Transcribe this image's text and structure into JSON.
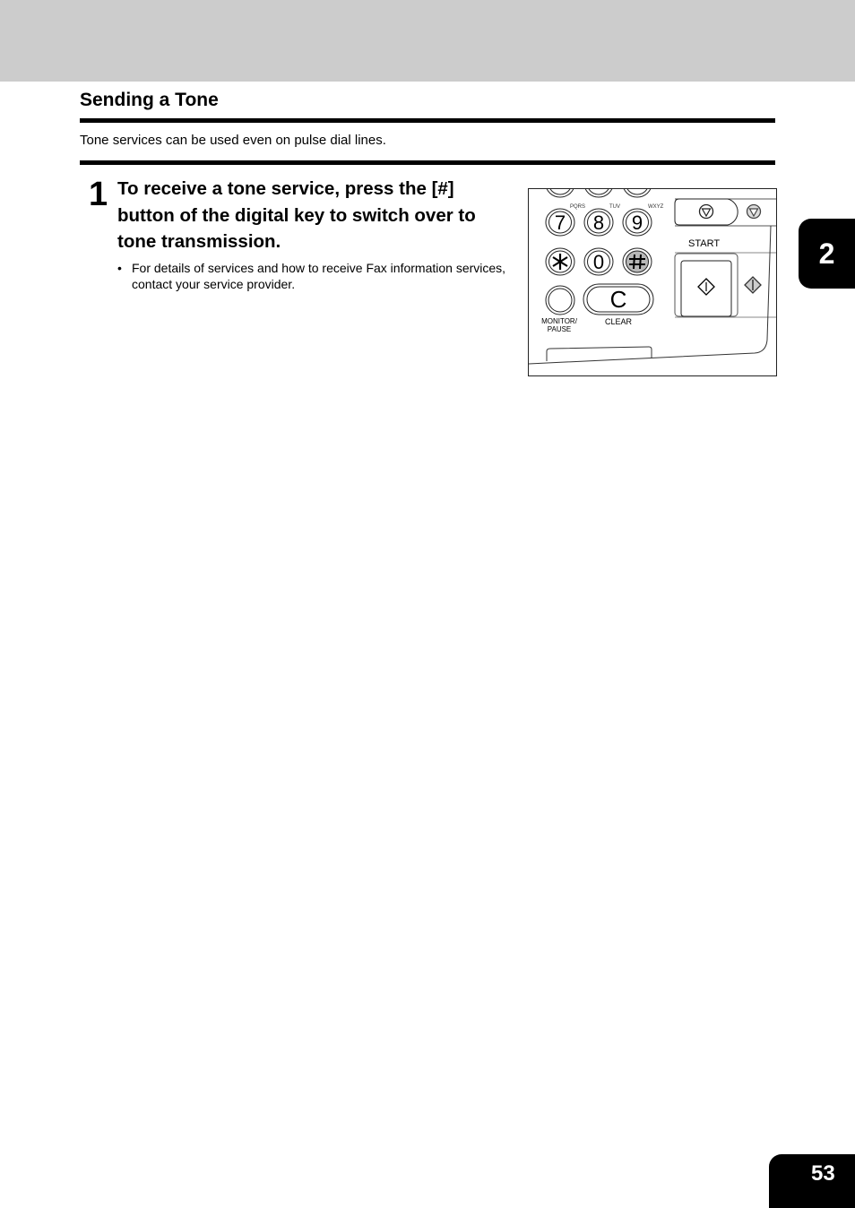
{
  "section": {
    "title": "Sending a Tone",
    "intro": "Tone services can be used even on pulse dial lines."
  },
  "step": {
    "number": "1",
    "instruction": "To receive a tone service, press the [#] button of the digital key to switch over to tone transmission.",
    "bullets": [
      "For details of services and how to receive Fax information services, contact your service provider."
    ],
    "bullet_symbol": "•"
  },
  "figure": {
    "keypad": {
      "letters": [
        "PQRS",
        "TUV",
        "WXYZ"
      ],
      "keys": [
        "7",
        "8",
        "9",
        "*",
        "0",
        "#"
      ],
      "highlighted_key": "#",
      "highlight_color": "#b8b8b8",
      "monitor_label_line1": "MONITOR/",
      "monitor_label_line2": "PAUSE",
      "clear_key": "C",
      "clear_label": "CLEAR"
    },
    "start_label": "START"
  },
  "tabs": {
    "chapter": "2",
    "page_number": "53"
  }
}
